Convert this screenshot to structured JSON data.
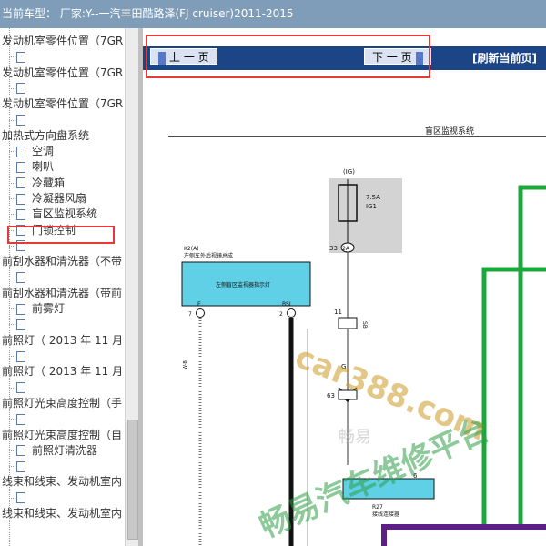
{
  "header": {
    "label": "当前车型：",
    "vendor": "厂家:Y--一汽丰田酷路泽(FJ cruiser)2011-2015"
  },
  "sidebar": {
    "rows": [
      {
        "text": "发动机室零件位置（7GR",
        "icon": false,
        "indent": 0
      },
      {
        "text": "",
        "icon": true,
        "indent": 1
      },
      {
        "text": "发动机室零件位置（7GR",
        "icon": false,
        "indent": 0
      },
      {
        "text": "",
        "icon": true,
        "indent": 1
      },
      {
        "text": "发动机室零件位置（7GR",
        "icon": false,
        "indent": 0
      },
      {
        "text": "",
        "icon": true,
        "indent": 1
      },
      {
        "text": "加热式方向盘系统",
        "icon": false,
        "indent": 0
      },
      {
        "text": "空调",
        "icon": true,
        "indent": 1
      },
      {
        "text": "喇叭",
        "icon": true,
        "indent": 1
      },
      {
        "text": "冷藏箱",
        "icon": true,
        "indent": 1
      },
      {
        "text": "冷凝器风扇",
        "icon": true,
        "indent": 1
      },
      {
        "text": "盲区监视系统",
        "icon": true,
        "indent": 1,
        "selected": true
      },
      {
        "text": "门锁控制",
        "icon": true,
        "indent": 1
      },
      {
        "text": "",
        "icon": true,
        "indent": 1
      },
      {
        "text": "前刮水器和清洗器（不带",
        "icon": false,
        "indent": 0
      },
      {
        "text": "",
        "icon": true,
        "indent": 1
      },
      {
        "text": "前刮水器和清洗器（带前",
        "icon": false,
        "indent": 0
      },
      {
        "text": "前雾灯",
        "icon": true,
        "indent": 1
      },
      {
        "text": "",
        "icon": true,
        "indent": 1
      },
      {
        "text": "前照灯（ 2013 年 11 月",
        "icon": false,
        "indent": 0
      },
      {
        "text": "",
        "icon": true,
        "indent": 1
      },
      {
        "text": "前照灯（ 2013 年 11 月",
        "icon": false,
        "indent": 0
      },
      {
        "text": "",
        "icon": true,
        "indent": 1
      },
      {
        "text": "前照灯光束高度控制（手",
        "icon": false,
        "indent": 0
      },
      {
        "text": "",
        "icon": true,
        "indent": 1
      },
      {
        "text": "前照灯光束高度控制（自",
        "icon": false,
        "indent": 0
      },
      {
        "text": "前照灯清洗器",
        "icon": true,
        "indent": 1
      },
      {
        "text": "",
        "icon": true,
        "indent": 1
      },
      {
        "text": "线束和线束、发动机室内",
        "icon": false,
        "indent": 0
      },
      {
        "text": "",
        "icon": true,
        "indent": 1
      },
      {
        "text": "线束和线束、发动机室内",
        "icon": false,
        "indent": 0
      }
    ]
  },
  "nav": {
    "prev": "上 一 页",
    "next": "下 一 页",
    "refresh": "[刷新当前页]"
  },
  "diagram": {
    "title": "盲区监视系统",
    "ig": "(IG)",
    "fuse_amp": "7.5A",
    "fuse_name": "IG1",
    "pin_33": "33",
    "pin_2a": "2A",
    "conn_k2": "K2(A)",
    "k2_desc": "左侧车外后视镜总成",
    "lamp": "左侧盲区监视器指示灯",
    "pin_e": "E",
    "pin_bsl": "BSL",
    "pin_7": "7",
    "pin_2": "2",
    "pin_11": "11",
    "pin_63": "63",
    "pin_6": "6",
    "r27": "R27",
    "r27_desc": "接线连接器",
    "w_b": "W-B",
    "w_g": "G",
    "w_sb": "SB"
  },
  "watermark": {
    "site": "car388.com",
    "brand": "畅易汽车维修平台",
    "small": "畅易"
  },
  "colors": {
    "header": "#7f9db9",
    "navbar": "#1c4587",
    "green": "#1aa83a",
    "purple": "#5c1f88",
    "highlight": "#e53935"
  }
}
